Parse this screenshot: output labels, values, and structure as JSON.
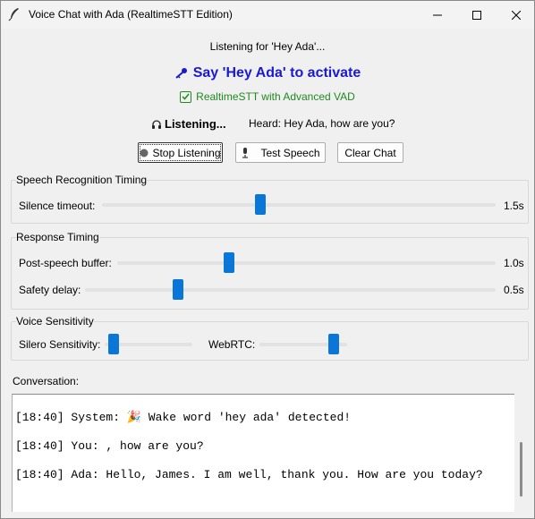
{
  "window": {
    "title": "Voice Chat with Ada (RealtimeSTT Edition)"
  },
  "status": {
    "listening_for": "Listening for 'Hey Ada'...",
    "headline": "Say 'Hey Ada' to activate",
    "engine": "RealtimeSTT with Advanced VAD",
    "state": "Listening...",
    "heard": "Heard: Hey Ada, how are you?"
  },
  "buttons": {
    "stop": "Stop Listening",
    "test": "Test Speech",
    "clear": "Clear Chat"
  },
  "speech_timing": {
    "title": "Speech Recognition Timing",
    "silence_label": "Silence timeout:",
    "silence_value": "1.5s",
    "silence_level": 0.4
  },
  "response_timing": {
    "title": "Response Timing",
    "buffer_label": "Post-speech buffer:",
    "buffer_value": "1.0s",
    "buffer_level": 0.29,
    "safety_label": "Safety delay:",
    "safety_value": "0.5s",
    "safety_level": 0.22
  },
  "voice_sensitivity": {
    "title": "Voice Sensitivity",
    "silero_label": "Silero Sensitivity:",
    "silero_level": 0.05,
    "webrtc_label": "WebRTC:",
    "webrtc_level": 0.9
  },
  "conversation": {
    "label": "Conversation:",
    "messages": [
      "[18:40] System: 🎉 Wake word 'hey ada' detected!",
      "[18:40] You: , how are you?",
      "[18:40] Ada: Hello, James. I am well, thank you. How are you today?"
    ]
  },
  "colors": {
    "accent": "#0a77d8",
    "headline": "#1a1ad0",
    "success": "#1f8a1f"
  }
}
